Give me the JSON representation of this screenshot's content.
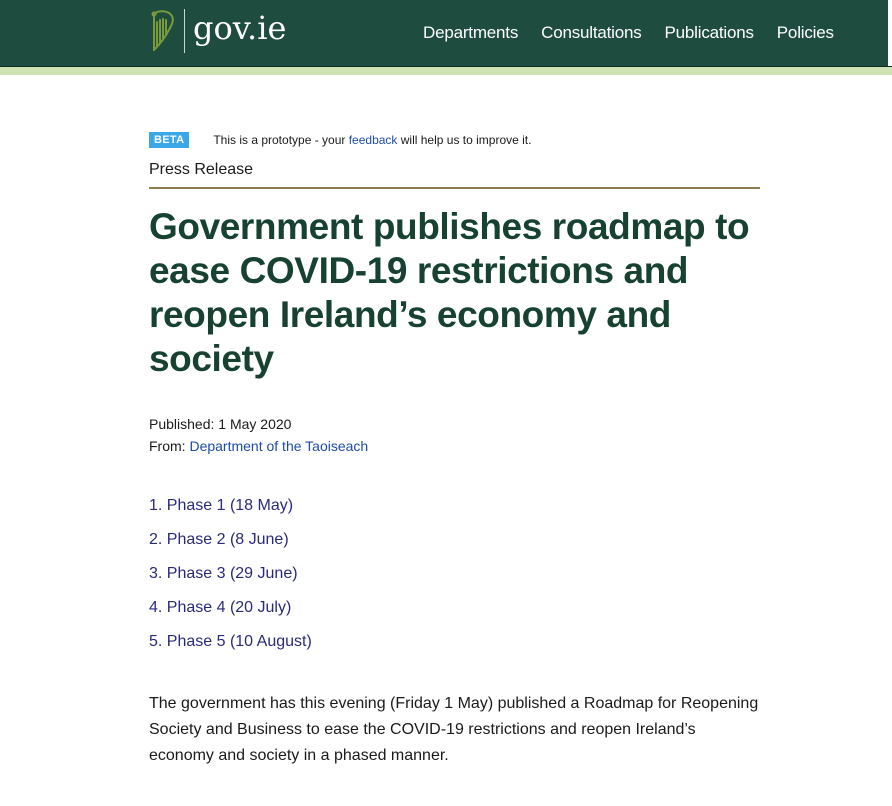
{
  "header": {
    "logo_text": "gov.ie",
    "nav": [
      {
        "label": "Departments"
      },
      {
        "label": "Consultations"
      },
      {
        "label": "Publications"
      },
      {
        "label": "Policies"
      }
    ],
    "colors": {
      "background": "#1e4c3e",
      "strip": "#cfe2b4"
    }
  },
  "beta": {
    "badge": "BETA",
    "text_before": "This is a prototype - your ",
    "link": "feedback",
    "text_after": " will help us to improve it."
  },
  "article": {
    "type": "Press Release",
    "title": "Government publishes roadmap to ease COVID-19 restrictions and reopen Ireland’s economy and society",
    "published_label": "Published: ",
    "published_date": "1 May 2020",
    "from_label": "From: ",
    "from_link": "Department of the Taoiseach",
    "phases": [
      {
        "number": "1.",
        "label": "Phase 1 (18 May)"
      },
      {
        "number": "2.",
        "label": "Phase 2 (8 June)"
      },
      {
        "number": "3.",
        "label": "Phase 3 (29 June)"
      },
      {
        "number": "4.",
        "label": "Phase 4 (20 July)"
      },
      {
        "number": "5.",
        "label": "Phase 5 (10 August)"
      }
    ],
    "intro": "The government has this evening (Friday 1 May) published a Roadmap for Reopening Society and Business to ease the COVID-19 restrictions and reopen Ireland’s economy and society in a phased manner."
  },
  "icons": {
    "logo": "harp-icon"
  }
}
